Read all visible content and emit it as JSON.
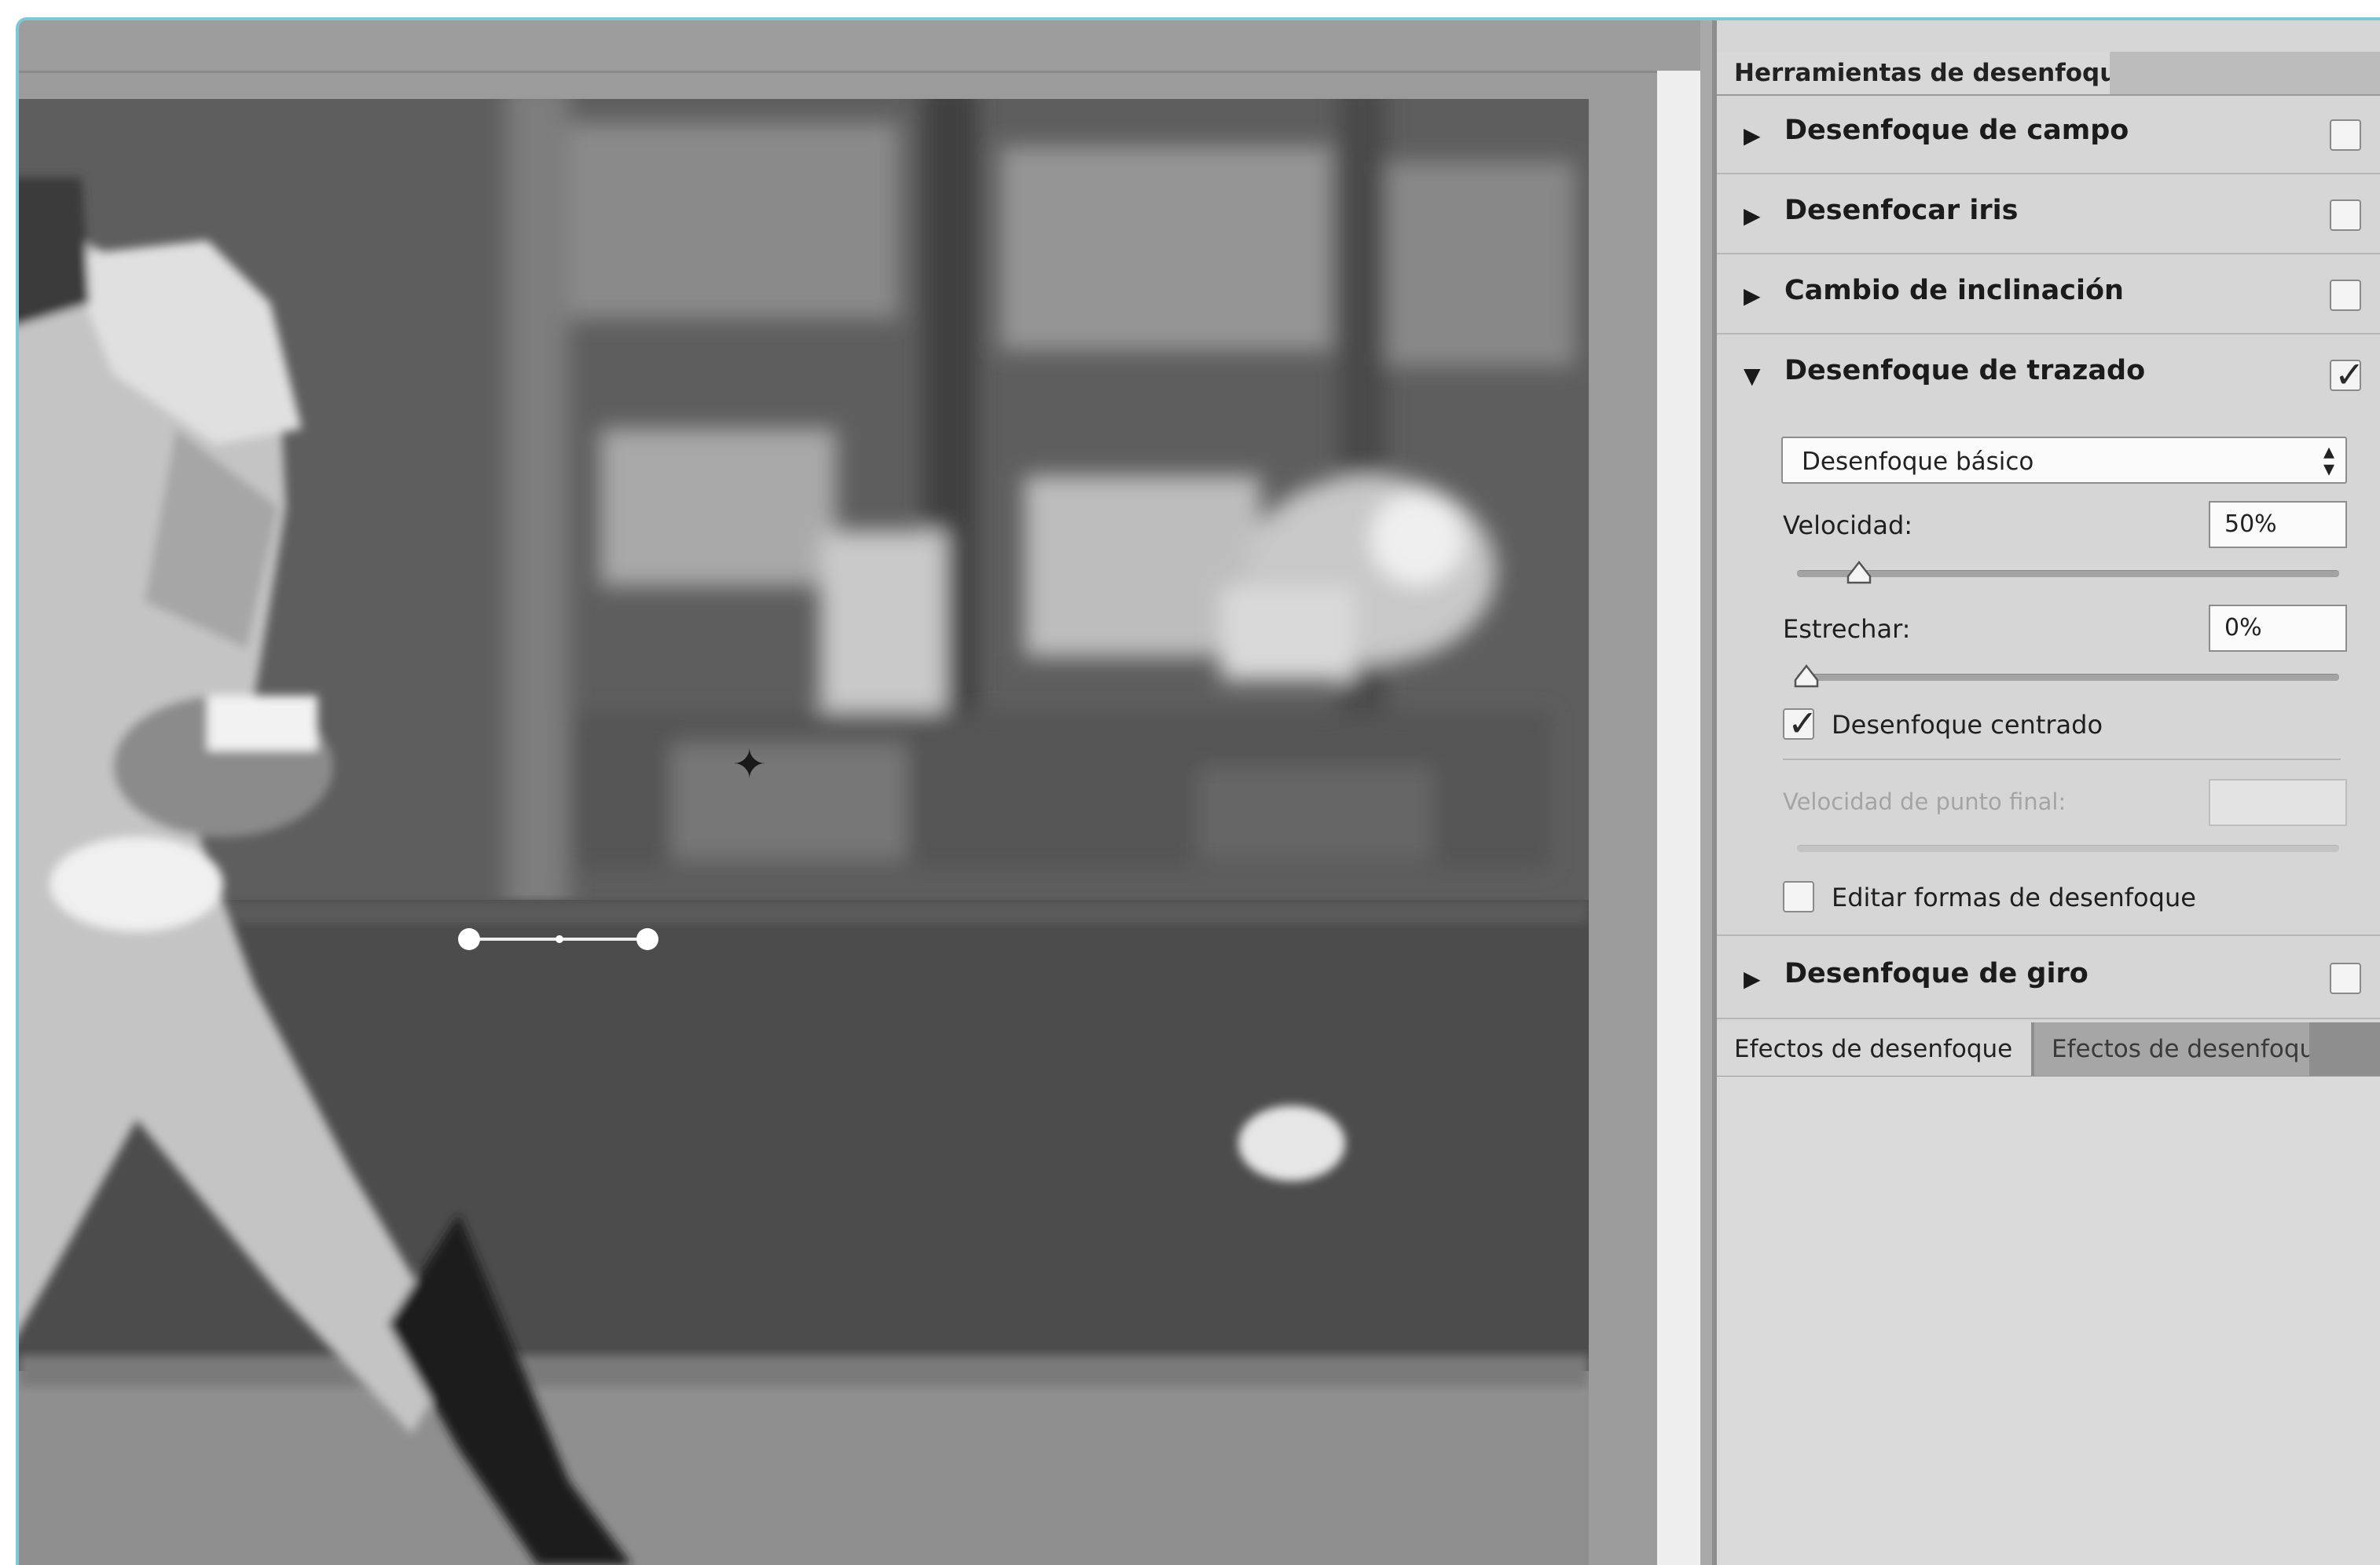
{
  "panel": {
    "top_tabs": [
      "Herramientas de desenfoque"
    ],
    "sections": [
      {
        "label": "Desenfoque de campo",
        "expanded": false,
        "checked": false
      },
      {
        "label": "Desenfocar iris",
        "expanded": false,
        "checked": false
      },
      {
        "label": "Cambio de inclinación",
        "expanded": false,
        "checked": false
      },
      {
        "label": "Desenfoque de trazado",
        "expanded": true,
        "checked": true
      },
      {
        "label": "Desenfoque de giro",
        "expanded": false,
        "checked": false
      }
    ],
    "path_blur": {
      "mode_select": "Desenfoque básico",
      "speed_label": "Velocidad:",
      "speed_value": "50%",
      "speed_fraction": 0.1,
      "taper_label": "Estrechar:",
      "taper_value": "0%",
      "taper_fraction": 0.0,
      "centered_blur_label": "Desenfoque centrado",
      "centered_blur_checked": true,
      "end_point_speed_label": "Velocidad de punto final:",
      "end_point_speed_enabled": false,
      "edit_shapes_label": "Editar formas de desenfoque",
      "edit_shapes_checked": false
    },
    "bottom_tabs": [
      "Efectos de desenfoque",
      "Efectos de desenfoque"
    ]
  },
  "icons": {
    "collapsed": "triangle-right-icon",
    "expanded": "triangle-down-icon",
    "cursor": "pin-add-cursor-icon",
    "select_arrows": "up-down-arrows-icon"
  },
  "colors": {
    "panel_bg": "#d6d6d6",
    "accent_frame": "#7fc6d6"
  }
}
